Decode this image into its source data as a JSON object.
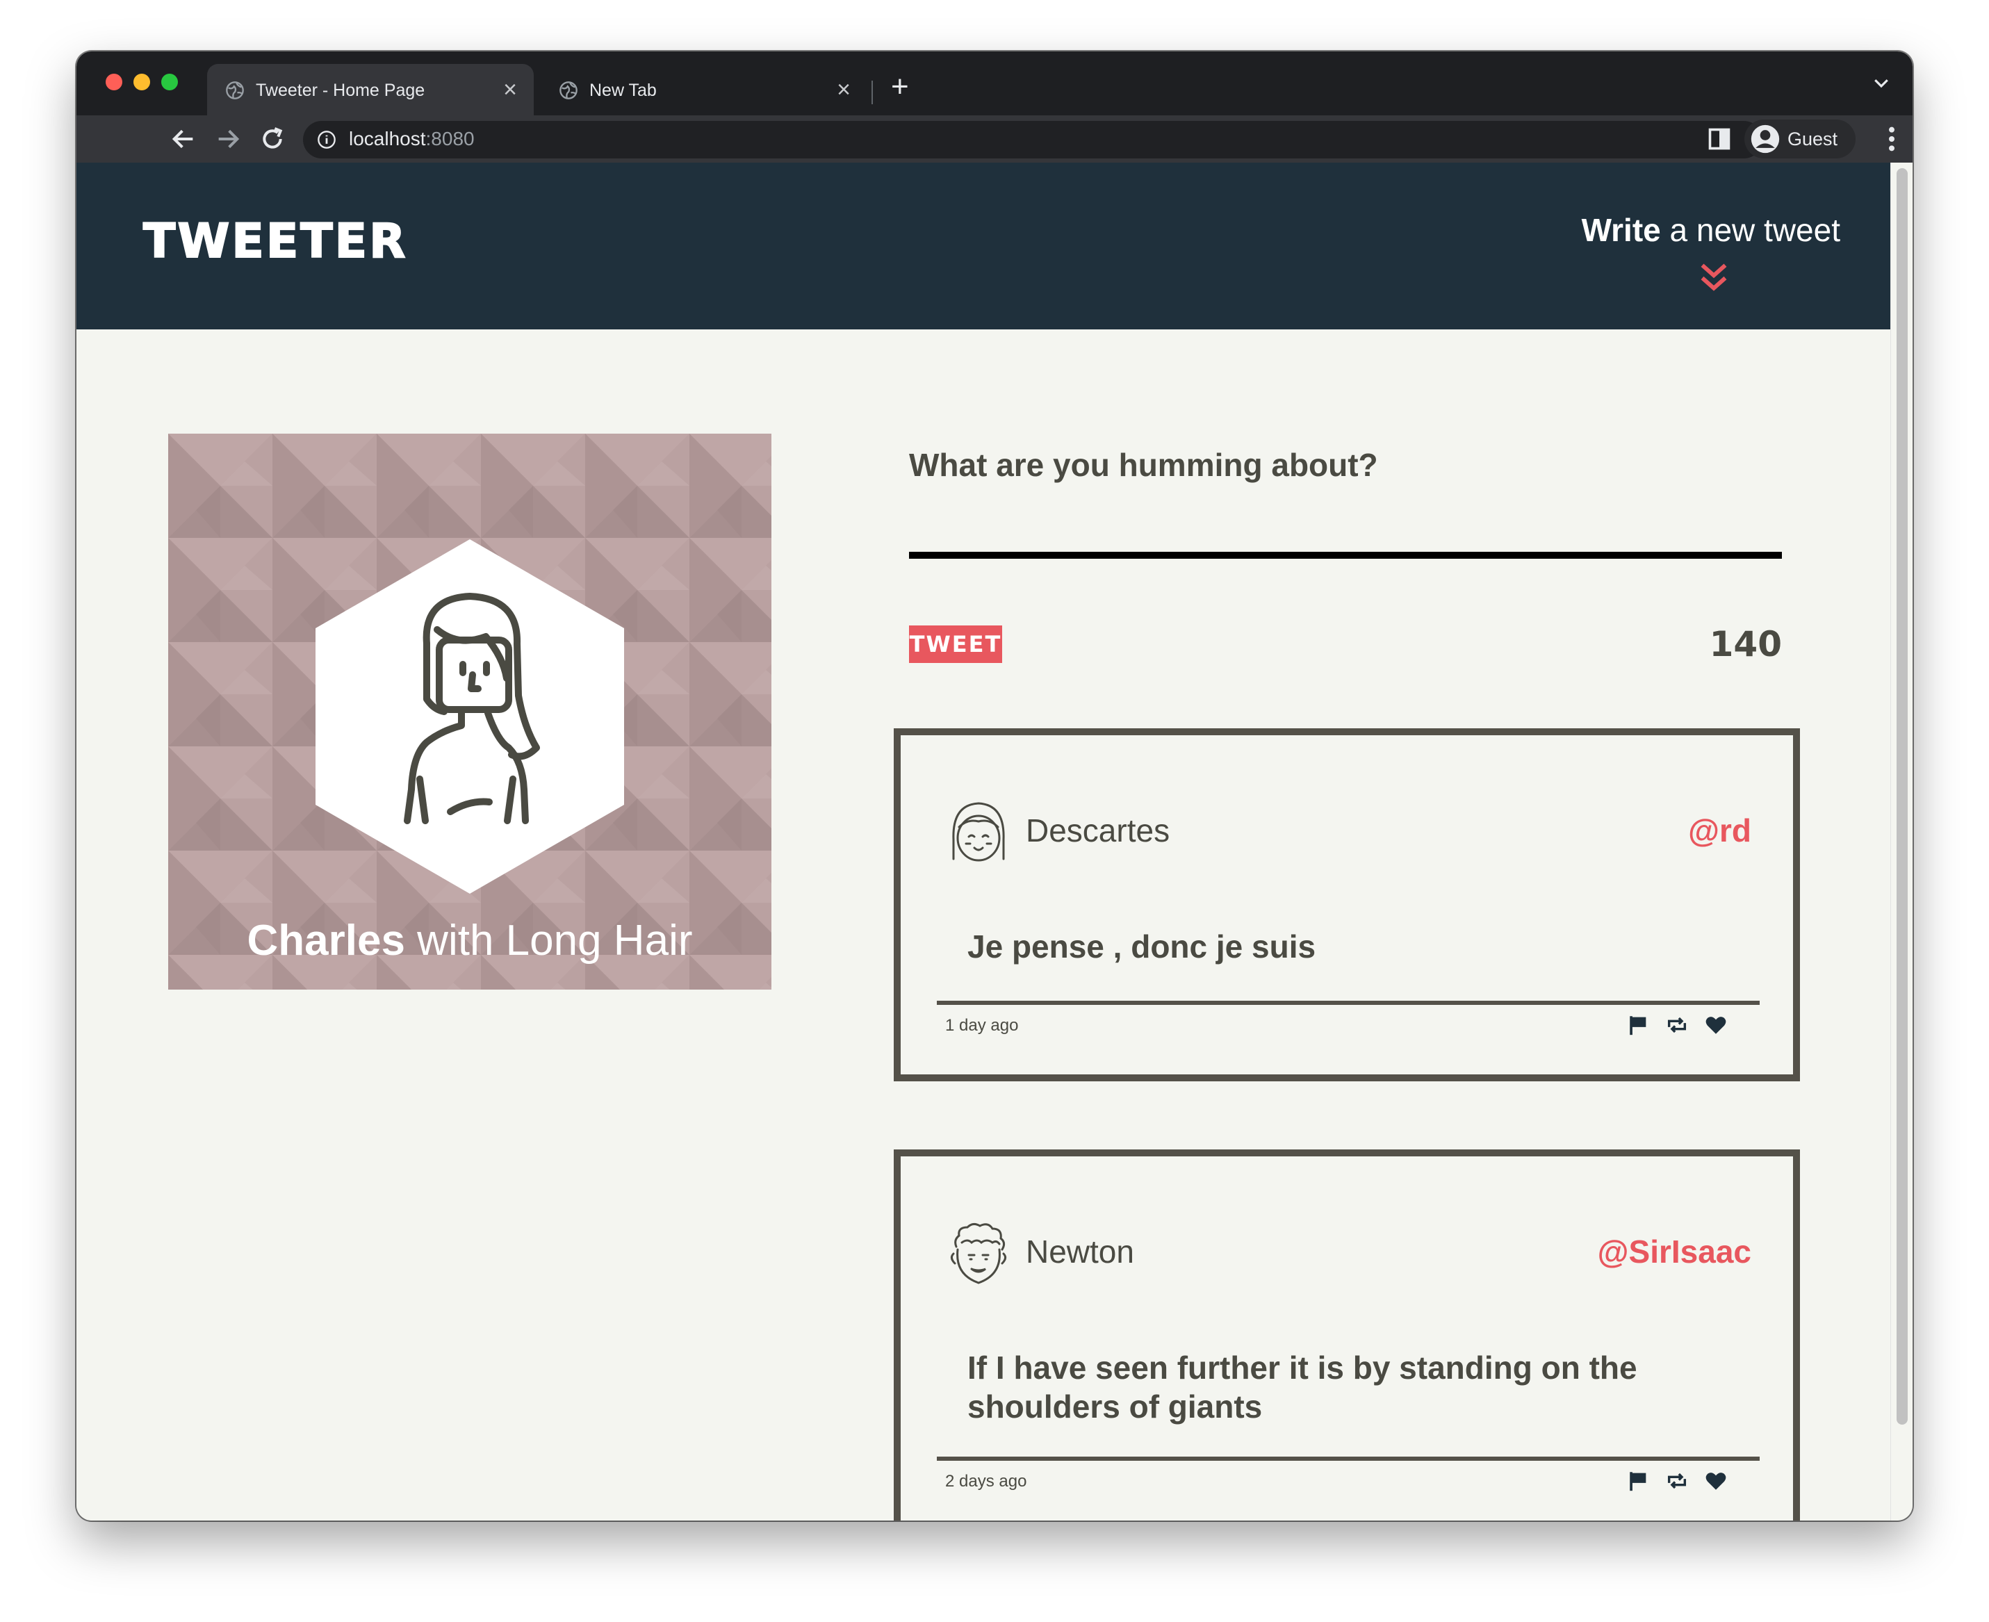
{
  "browser": {
    "tabs": [
      {
        "title": "Tweeter - Home Page",
        "active": true
      },
      {
        "title": "New Tab",
        "active": false
      }
    ],
    "url_host": "localhost",
    "url_port": ":8080",
    "profile_name": "Guest"
  },
  "header": {
    "logo": "TWEETER",
    "write_strong": "Write",
    "write_rest": " a new tweet",
    "accent_color": "#e8575e",
    "background_color": "#1f303c"
  },
  "profile": {
    "first_name": "Charles",
    "rest_name": " with Long Hair",
    "card_color": "#b69d9d"
  },
  "compose": {
    "label": "What are you humming about?",
    "input_value": "",
    "button_label": "TWEET",
    "counter": "140"
  },
  "tweets": [
    {
      "author": "Descartes",
      "handle": "@rd",
      "content": "Je pense , donc je suis",
      "time": "1 day ago",
      "avatar_icon": "girl-face-avatar-icon"
    },
    {
      "author": "Newton",
      "handle": "@SirIsaac",
      "content": "If I have seen further it is by standing on the shoulders of giants",
      "time": "2 days ago",
      "avatar_icon": "curly-hair-avatar-icon"
    }
  ],
  "icons": {
    "actions": [
      "flag-icon",
      "retweet-icon",
      "heart-icon"
    ]
  }
}
